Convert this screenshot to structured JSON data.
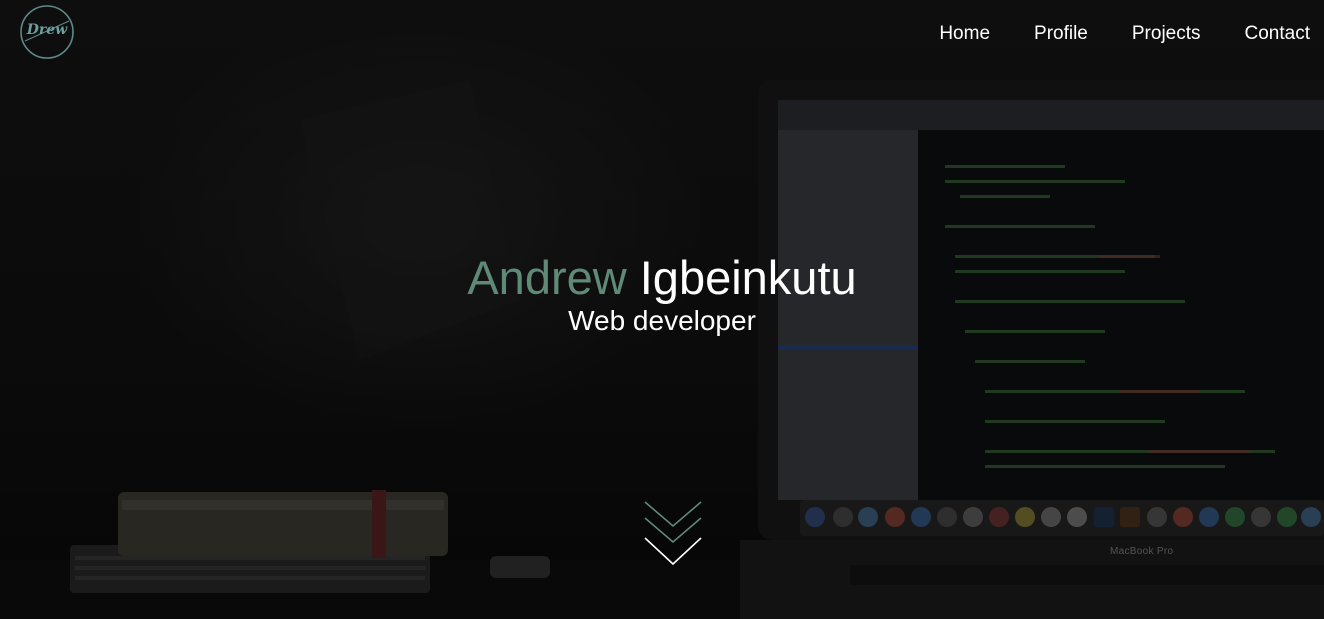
{
  "logo": {
    "text": "Drew",
    "icon": "drew-logo-icon"
  },
  "nav": {
    "items": [
      {
        "label": "Home"
      },
      {
        "label": "Profile"
      },
      {
        "label": "Projects"
      },
      {
        "label": "Contact"
      }
    ]
  },
  "hero": {
    "first_name": "Andrew",
    "last_name": "Igbeinkutu",
    "role": "Web developer",
    "laptop_label": "MacBook Pro",
    "scroll_icon": "chevron-double-down-icon"
  },
  "colors": {
    "accent": "#5f8a78",
    "text": "#ffffff",
    "background": "#111111"
  }
}
